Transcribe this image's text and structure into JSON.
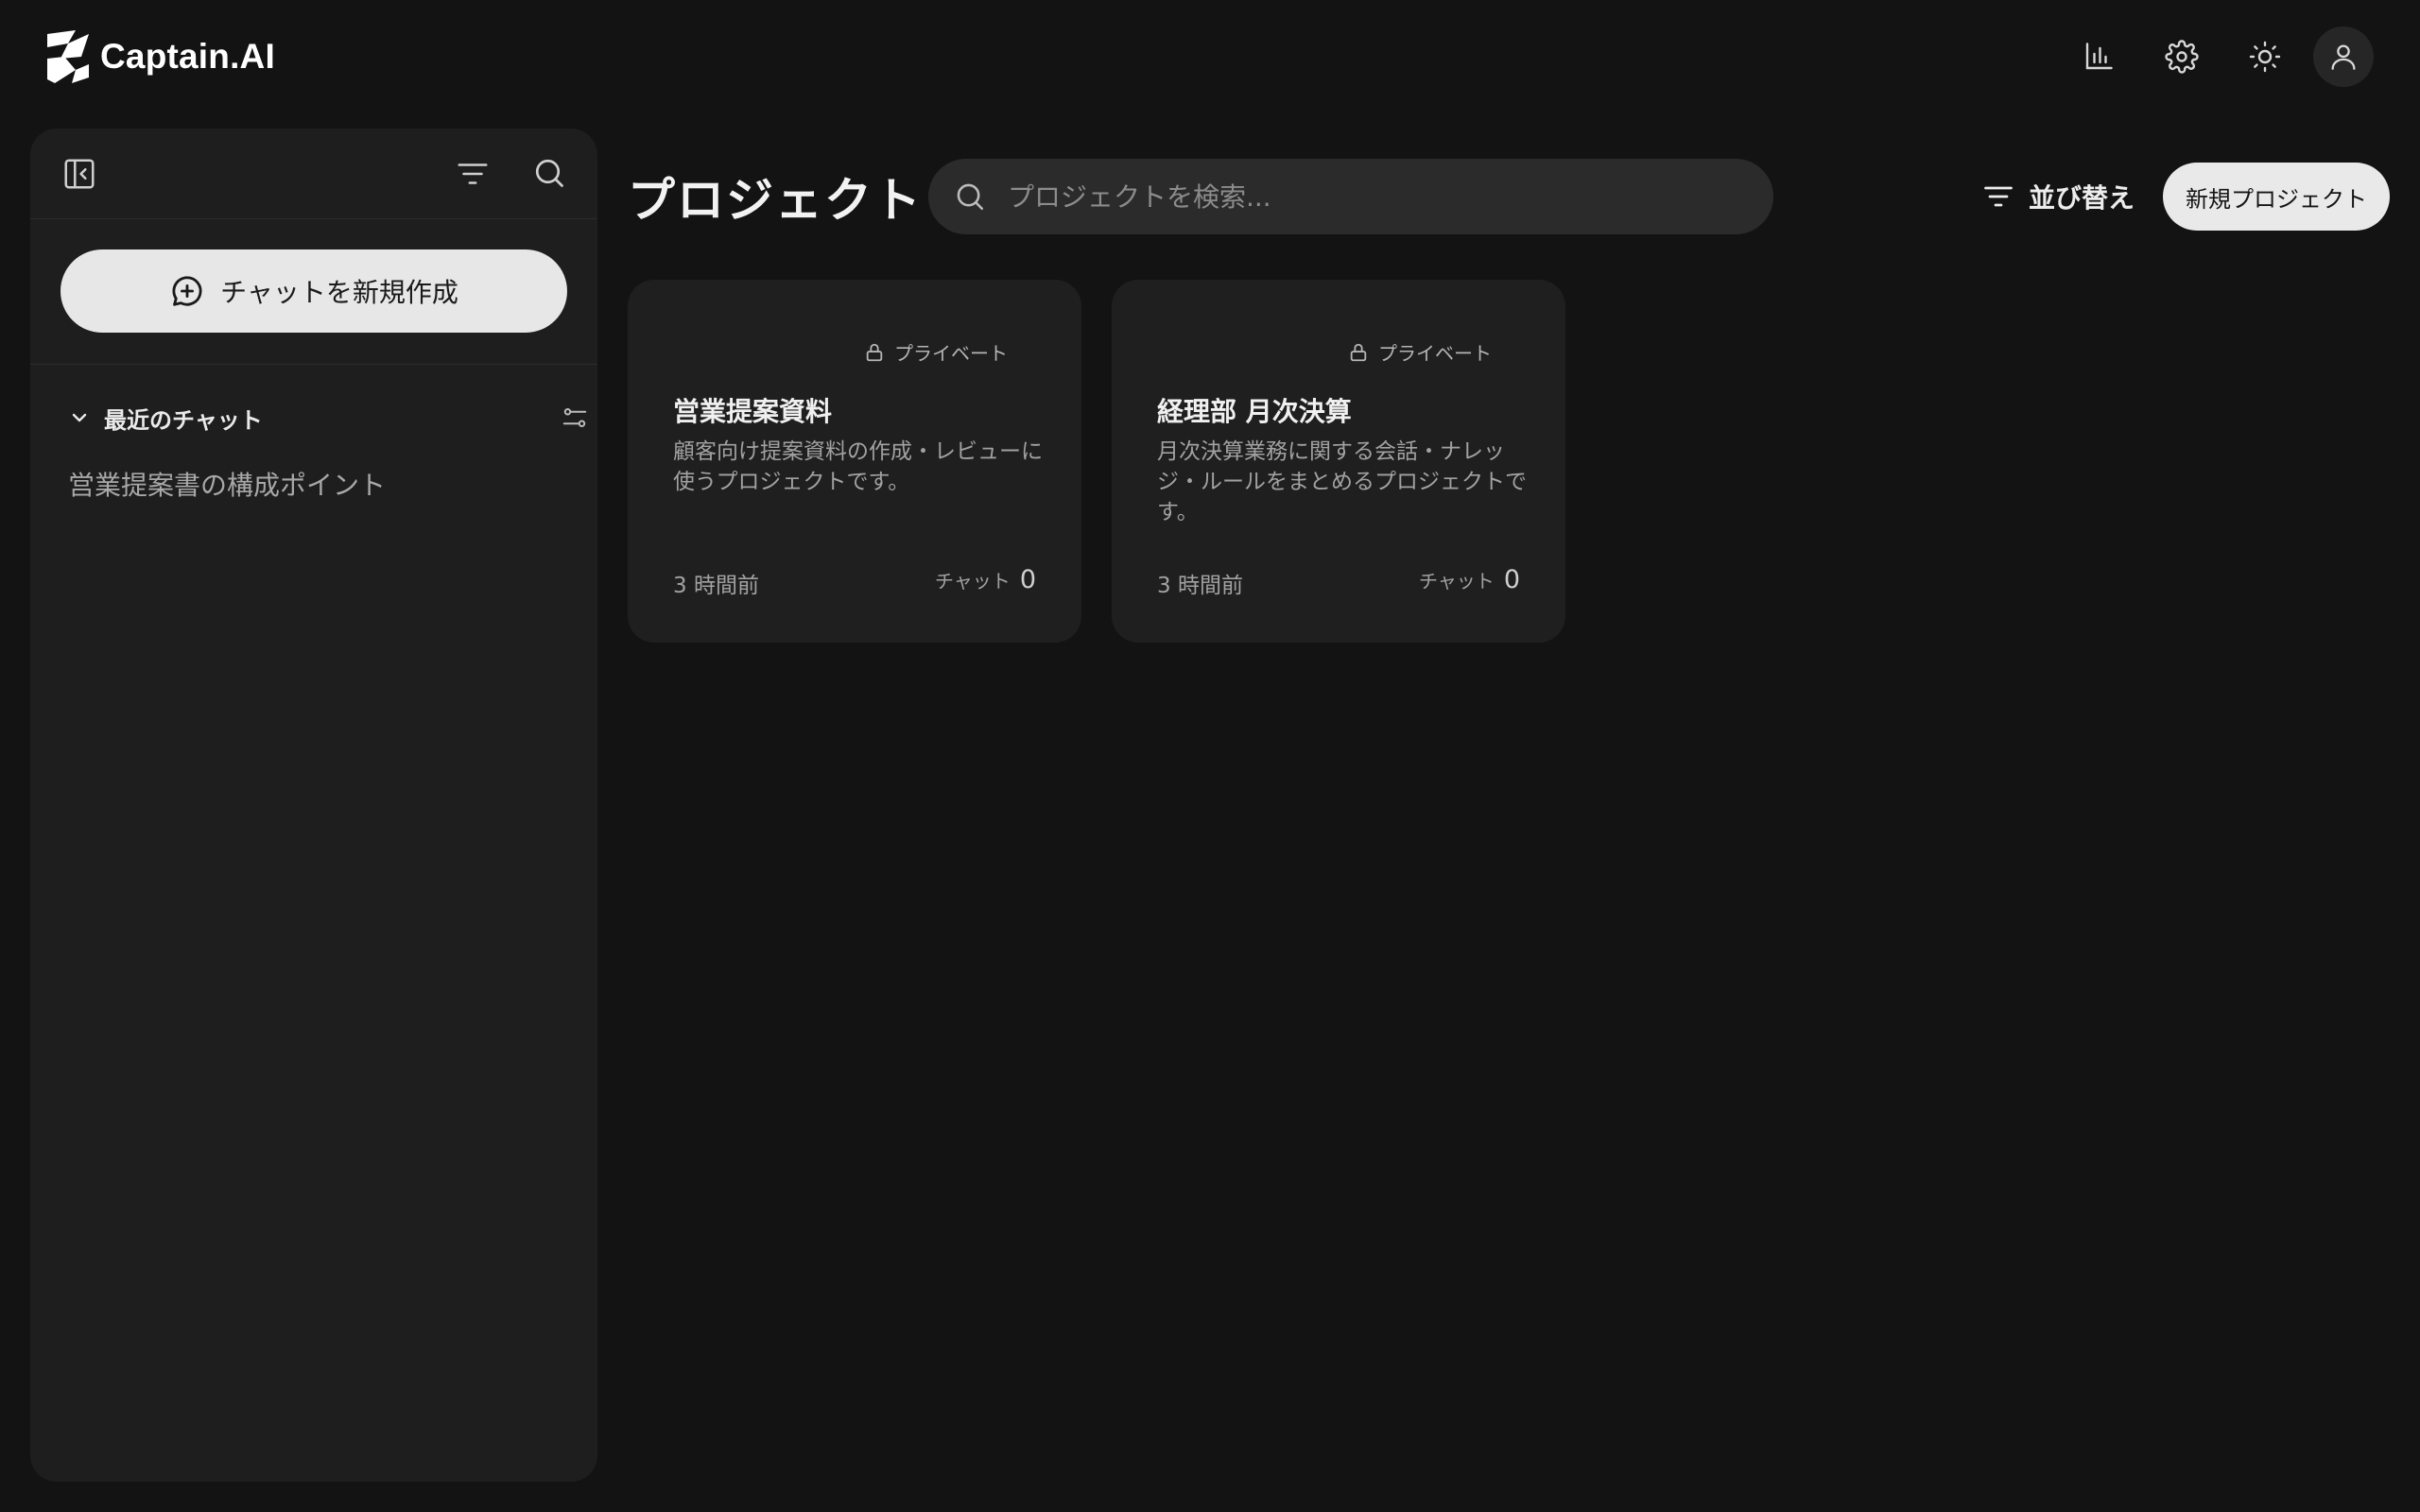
{
  "app": {
    "name": "Captain.AI"
  },
  "header": {
    "icons": [
      "bar-chart-icon",
      "gear-icon",
      "sun-icon",
      "user-icon"
    ]
  },
  "sidebar": {
    "new_chat_label": "チャットを新規作成",
    "recent_label": "最近のチャット",
    "chats": [
      {
        "title": "営業提案書の構成ポイント"
      }
    ]
  },
  "main": {
    "title": "プロジェクト",
    "search_placeholder": "プロジェクトを検索...",
    "sort_label": "並び替え",
    "new_project_label": "新規プロジェクト",
    "projects": [
      {
        "visibility": "プライベート",
        "title": "営業提案資料",
        "description": "顧客向け提案資料の作成・レビューに使うプロジェクトです。",
        "updated": "3 時間前",
        "chat_label": "チャット",
        "chat_count": "0"
      },
      {
        "visibility": "プライベート",
        "title": "経理部 月次決算",
        "description": "月次決算業務に関する会話・ナレッジ・ルールをまとめるプロジェクトです。",
        "updated": "3 時間前",
        "chat_label": "チャット",
        "chat_count": "0"
      }
    ]
  },
  "colors": {
    "background": "#131313",
    "panel": "#1e1e1e",
    "card": "#1f1f1f",
    "button_light": "#e7e7e8",
    "search_bg": "#2b2b2b"
  }
}
